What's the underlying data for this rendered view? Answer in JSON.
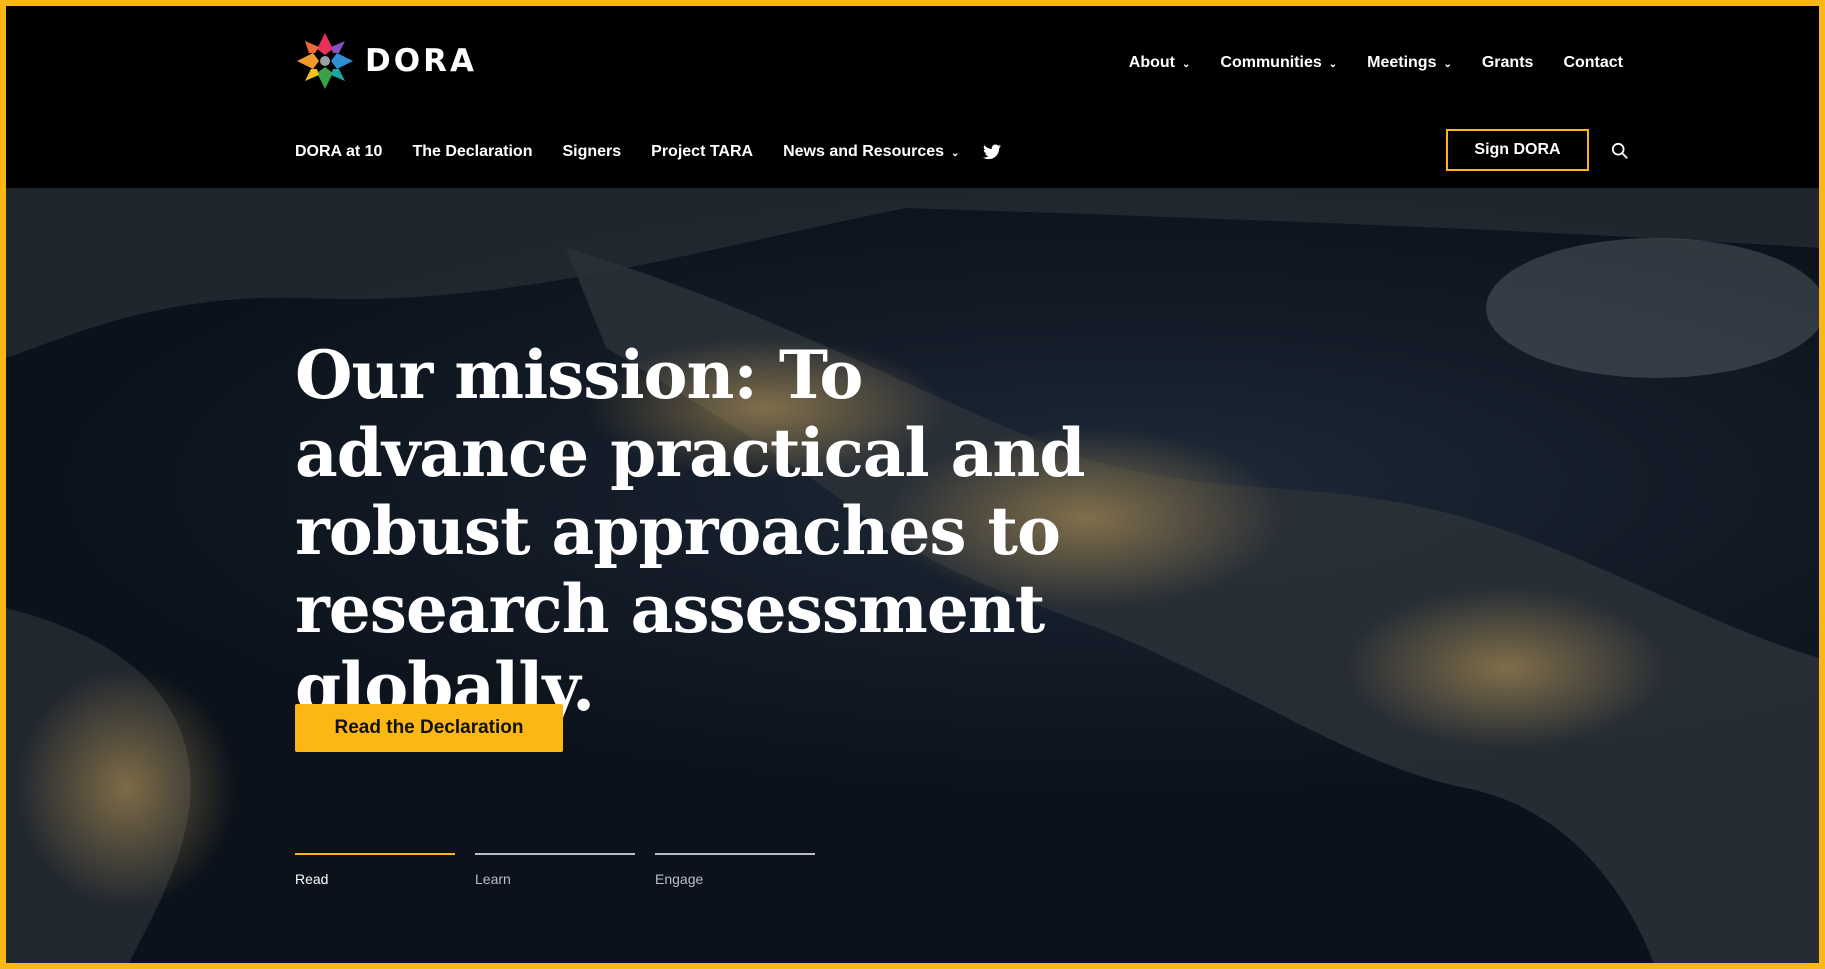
{
  "brand": {
    "name": "DORA"
  },
  "top_nav": [
    {
      "label": "About",
      "dropdown": true
    },
    {
      "label": "Communities",
      "dropdown": true
    },
    {
      "label": "Meetings",
      "dropdown": true
    },
    {
      "label": "Grants",
      "dropdown": false
    },
    {
      "label": "Contact",
      "dropdown": false
    }
  ],
  "sub_nav": [
    {
      "label": "DORA at 10"
    },
    {
      "label": "The Declaration"
    },
    {
      "label": "Signers"
    },
    {
      "label": "Project TARA"
    },
    {
      "label": "News and Resources",
      "dropdown": true
    }
  ],
  "sign_button": "Sign DORA",
  "hero": {
    "title": "Our mission: To advance practical and robust approaches to research assessment globally.",
    "cta": "Read the Declaration",
    "tabs": [
      {
        "label": "Read",
        "active": true
      },
      {
        "label": "Learn",
        "active": false
      },
      {
        "label": "Engage",
        "active": false
      }
    ]
  },
  "colors": {
    "accent": "#fbb714",
    "header_bg": "#000000",
    "text": "#ffffff"
  },
  "icons": {
    "twitter": "twitter-icon",
    "search": "search-icon",
    "chevron": "chevron-down-icon"
  }
}
